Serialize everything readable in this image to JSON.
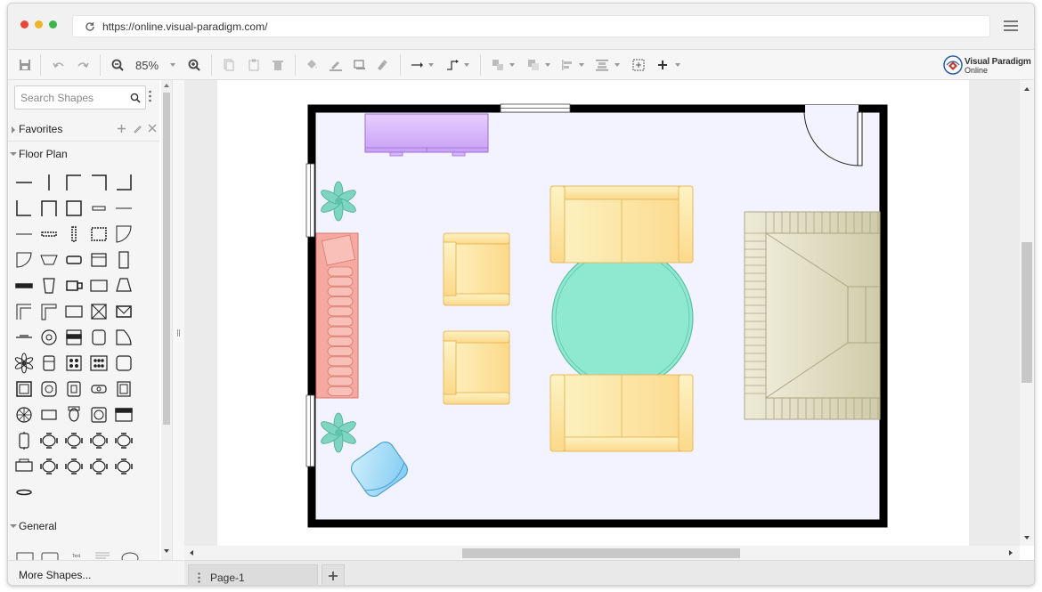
{
  "browser": {
    "url": "https://online.visual-paradigm.com/",
    "dots": [
      "#e8473a",
      "#f0b429",
      "#3cb44b"
    ]
  },
  "toolbar": {
    "zoom_label": "85%",
    "logo_name": "Visual Paradigm",
    "logo_sub": "Online"
  },
  "sidebar": {
    "search_placeholder": "Search Shapes",
    "favorites_label": "Favorites",
    "floor_plan_label": "Floor Plan",
    "general_label": "General",
    "more_shapes_label": "More Shapes...",
    "general_text_sample": "Text"
  },
  "pages": {
    "current_tab": "Page-1"
  },
  "colors": {
    "accent": "#c0392b",
    "wall": "#000000",
    "floor": "#f3f3ff",
    "cabinet": "#d8b4fe",
    "sofa_red": "#f5a9a0",
    "armchair": "#fde8a8",
    "rug": "#8fe8d0",
    "bed": "#ddd9be",
    "plant": "#7ed6c0",
    "chair_blue": "#a8dcf7"
  }
}
